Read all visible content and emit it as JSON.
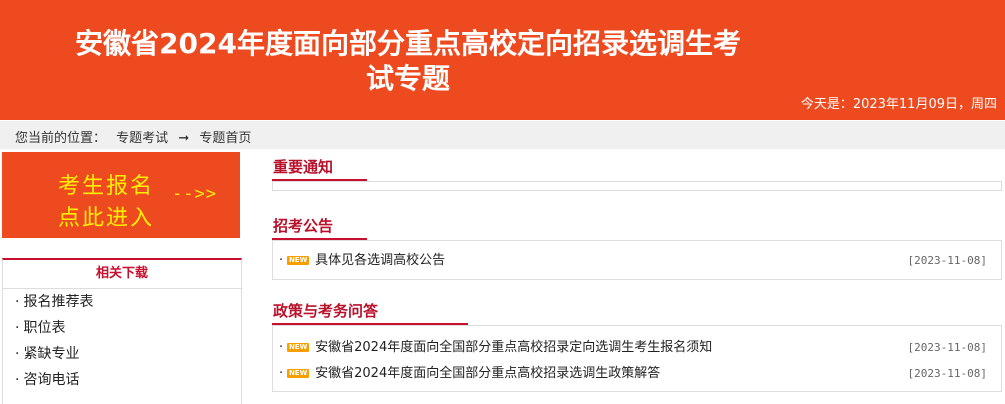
{
  "header": {
    "title_line1": "安徽省2024年度面向部分重点高校定向招录选调生考",
    "title_line2": "试专题",
    "date": "今天是：2023年11月09日，周四",
    "bg_color": "#ee4a20"
  },
  "breadcrumb": {
    "prefix": "您当前的位置：",
    "item1": "专题考试",
    "arrow": "➞",
    "item2": "专题首页"
  },
  "register": {
    "line1": "考生报名",
    "line2": "点此进入",
    "arrow": "-->>"
  },
  "downloads": {
    "title": "相关下载",
    "items": [
      {
        "label": "报名推荐表"
      },
      {
        "label": "职位表"
      },
      {
        "label": "紧缺专业"
      },
      {
        "label": "咨询电话"
      }
    ]
  },
  "sections": {
    "notices": {
      "title": "重要通知"
    },
    "announcements": {
      "title": "招考公告",
      "items": [
        {
          "text": "具体见各选调高校公告",
          "date": "[2023-11-08]",
          "badge": "NEW"
        }
      ]
    },
    "policy": {
      "title": "政策与考务问答",
      "items": [
        {
          "text": "安徽省2024年度面向全国部分重点高校招录定向选调生考生报名须知",
          "date": "[2023-11-08]",
          "badge": "NEW"
        },
        {
          "text": "安徽省2024年度面向全国部分重点高校招录选调生政策解答",
          "date": "[2023-11-08]",
          "badge": "NEW"
        }
      ]
    }
  },
  "colors": {
    "accent": "#c8102e",
    "banner": "#ee4a20",
    "banner_text": "#ffee00",
    "badge": "#f6a000"
  }
}
